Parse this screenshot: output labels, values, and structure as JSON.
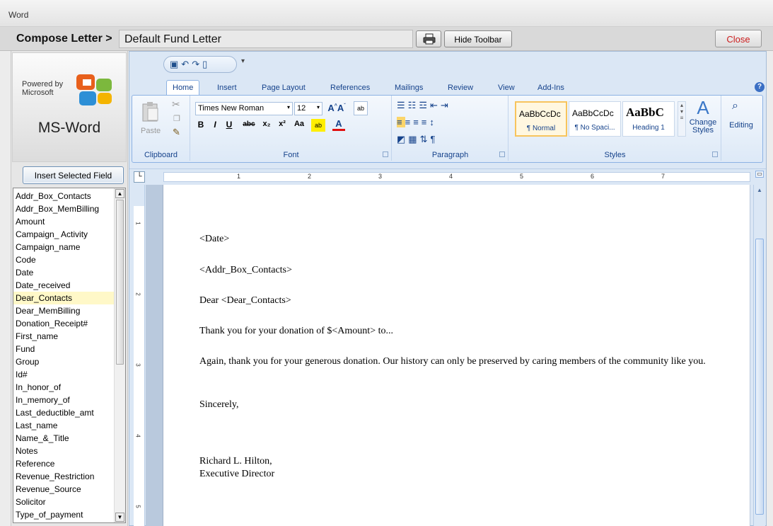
{
  "window": {
    "title": "Word"
  },
  "compose": {
    "label": "Compose Letter >",
    "letter_name": "Default Fund Letter",
    "hide_toolbar": "Hide Toolbar",
    "close": "Close"
  },
  "left": {
    "powered_by": "Powered by Microsoft",
    "product": "MS-Word",
    "insert_field": "Insert Selected Field",
    "selected_field": "Dear_Contacts",
    "fields": [
      "Addr_Box_Contacts",
      "Addr_Box_MemBilling",
      "Amount",
      "Campaign_ Activity",
      "Campaign_name",
      "Code",
      "Date",
      "Date_received",
      "Dear_Contacts",
      "Dear_MemBilling",
      "Donation_Receipt#",
      "First_name",
      "Fund",
      "Group",
      "Id#",
      "In_honor_of",
      "In_memory_of",
      "Last_deductible_amt",
      "Last_name",
      "Name_&_Title",
      "Notes",
      "Reference",
      "Revenue_Restriction",
      "Revenue_Source",
      "Solicitor",
      "Type_of_payment"
    ]
  },
  "ribbon": {
    "tabs": [
      "Home",
      "Insert",
      "Page Layout",
      "References",
      "Mailings",
      "Review",
      "View",
      "Add-Ins"
    ],
    "active_tab": "Home",
    "groups": {
      "clipboard": "Clipboard",
      "font": "Font",
      "paragraph": "Paragraph",
      "styles": "Styles"
    },
    "paste": "Paste",
    "font_name": "Times New Roman",
    "font_size": "12",
    "styles": [
      {
        "sample": "AaBbCcDc",
        "name": "¶ Normal"
      },
      {
        "sample": "AaBbCcDc",
        "name": "¶ No Spaci..."
      },
      {
        "sample": "AaBbC",
        "name": "Heading 1"
      }
    ],
    "change_styles": "Change Styles",
    "editing": "Editing"
  },
  "ruler": {
    "numbers": [
      "1",
      "2",
      "3",
      "4",
      "5",
      "6",
      "7"
    ],
    "vnumbers": [
      "1",
      "2",
      "3",
      "4",
      "5"
    ]
  },
  "document": {
    "lines": [
      "<Date>",
      "<Addr_Box_Contacts>",
      "Dear <Dear_Contacts>",
      "Thank you for your donation of $<Amount> to...",
      "Again, thank you for your generous donation.  Our history can only be preserved by caring members of the community like you.",
      "Sincerely,",
      "Richard L. Hilton,",
      "Executive Director"
    ]
  },
  "colors": {
    "accent": "#15428b",
    "selection": "#fff8c8",
    "close_text": "#cc1d1d"
  }
}
